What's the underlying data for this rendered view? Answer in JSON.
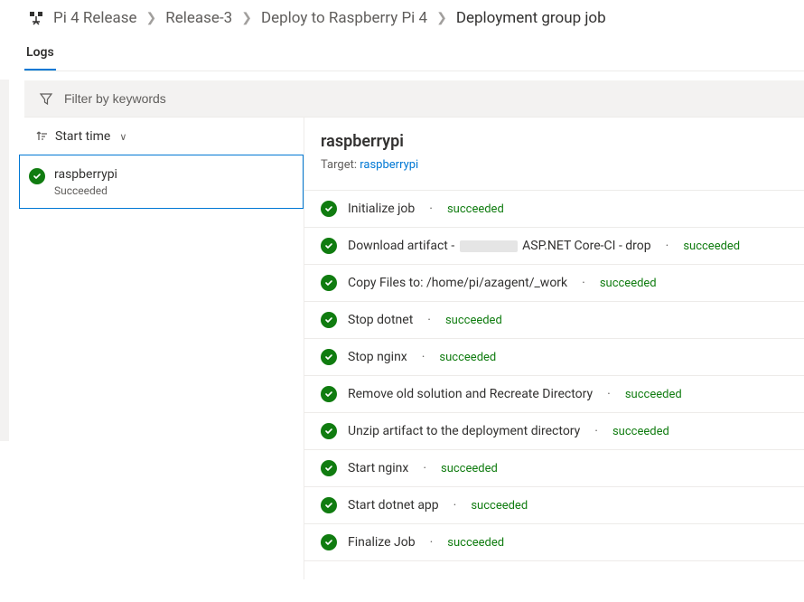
{
  "breadcrumb": {
    "items": [
      {
        "label": "Pi 4 Release"
      },
      {
        "label": "Release-3"
      },
      {
        "label": "Deploy to Raspberry Pi 4"
      },
      {
        "label": "Deployment group job"
      }
    ]
  },
  "tabs": {
    "logs": "Logs"
  },
  "filter": {
    "placeholder": "Filter by keywords"
  },
  "sort": {
    "label": "Start time"
  },
  "target_list": {
    "items": [
      {
        "name": "raspberrypi",
        "status": "Succeeded"
      }
    ]
  },
  "detail": {
    "title": "raspberrypi",
    "target_label": "Target:",
    "target_value": "raspberrypi",
    "steps": [
      {
        "name": "Initialize job",
        "status": "succeeded",
        "obscured": false
      },
      {
        "name_prefix": "Download artifact - ",
        "name_suffix": "ASP.NET Core-CI - drop",
        "status": "succeeded",
        "obscured": true
      },
      {
        "name": "Copy Files to: /home/pi/azagent/_work",
        "status": "succeeded",
        "obscured": false
      },
      {
        "name": "Stop dotnet",
        "status": "succeeded",
        "obscured": false
      },
      {
        "name": "Stop nginx",
        "status": "succeeded",
        "obscured": false
      },
      {
        "name": "Remove old solution and Recreate Directory",
        "status": "succeeded",
        "obscured": false
      },
      {
        "name": "Unzip artifact to the deployment directory",
        "status": "succeeded",
        "obscured": false
      },
      {
        "name": "Start nginx",
        "status": "succeeded",
        "obscured": false
      },
      {
        "name": "Start dotnet app",
        "status": "succeeded",
        "obscured": false
      },
      {
        "name": "Finalize Job",
        "status": "succeeded",
        "obscured": false
      }
    ]
  },
  "colors": {
    "success": "#107c10",
    "accent": "#0078d4"
  }
}
